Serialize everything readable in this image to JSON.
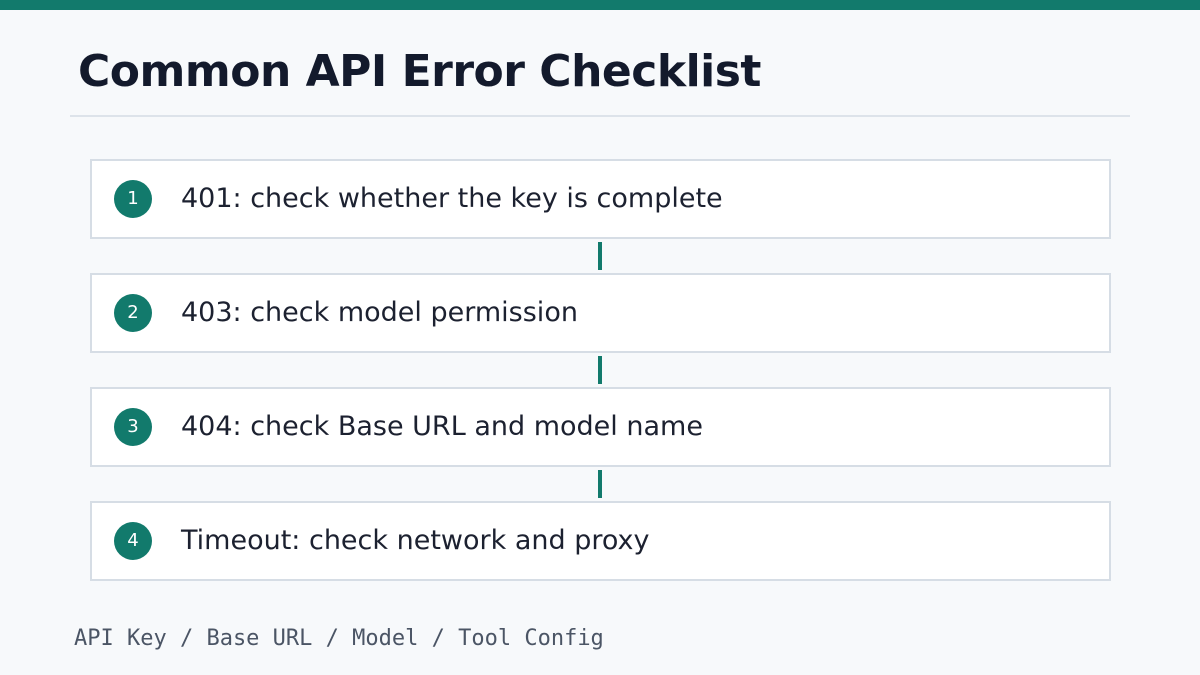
{
  "title": "Common API Error Checklist",
  "colors": {
    "accent": "#127a6c",
    "background": "#f7f9fb",
    "card_border": "#d6dde5",
    "title_text": "#131a2c"
  },
  "checklist": [
    {
      "number": "1",
      "text": "401: check whether the key is complete"
    },
    {
      "number": "2",
      "text": "403: check model permission"
    },
    {
      "number": "3",
      "text": "404: check Base URL and model name"
    },
    {
      "number": "4",
      "text": "Timeout: check network and proxy"
    }
  ],
  "footer": "API Key / Base URL / Model / Tool Config"
}
